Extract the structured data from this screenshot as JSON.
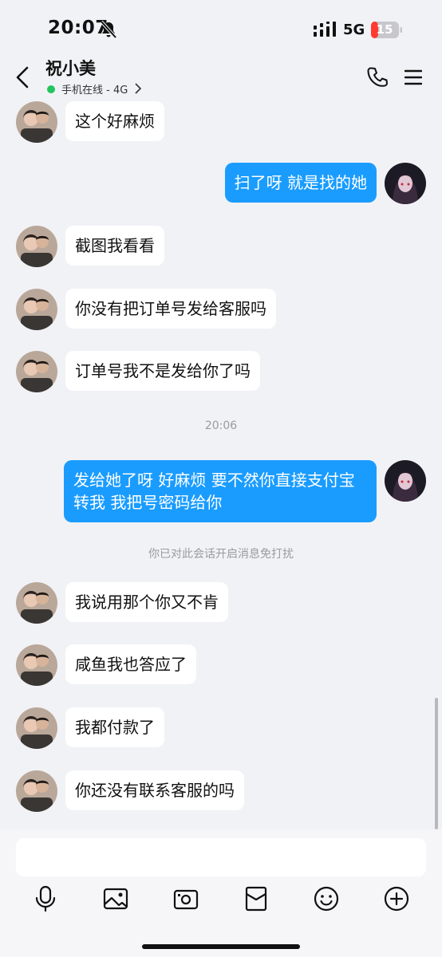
{
  "status_bar": {
    "time": "20:07",
    "network": "5G",
    "battery": "15",
    "icons": [
      "bell-off-icon",
      "signal-icon",
      "battery-icon"
    ]
  },
  "header": {
    "contact_name": "祝小美",
    "online_status": "手机在线 - 4G",
    "icons": [
      "back-icon",
      "phone-icon",
      "menu-icon"
    ]
  },
  "messages": [
    {
      "side": "in",
      "text": "这个好麻烦"
    },
    {
      "side": "out",
      "text": "扫了呀 就是找的她"
    },
    {
      "side": "in",
      "text": "截图我看看"
    },
    {
      "side": "in",
      "text": "你没有把订单号发给客服吗"
    },
    {
      "side": "in",
      "text": "订单号我不是发给你了吗"
    },
    {
      "side": "time",
      "text": "20:06"
    },
    {
      "side": "out",
      "text": "发给她了呀 好麻烦 要不然你直接支付宝转我 我把号密码给你"
    },
    {
      "side": "notice",
      "text": "你已对此会话开启消息免打扰"
    },
    {
      "side": "in",
      "text": "我说用那个你又不肯"
    },
    {
      "side": "in",
      "text": "咸鱼我也答应了"
    },
    {
      "side": "in",
      "text": "我都付款了"
    },
    {
      "side": "in",
      "text": "你还没有联系客服的吗"
    }
  ],
  "composer": {
    "input_value": "",
    "input_placeholder": "",
    "tools": [
      "microphone-icon",
      "image-icon",
      "camera-icon",
      "red-envelope-icon",
      "emoji-icon",
      "plus-icon"
    ]
  },
  "colors": {
    "background": "#f1f2f6",
    "incoming_bubble": "#ffffff",
    "outgoing_bubble": "#1a9cff",
    "online": "#22c55e",
    "battery_low": "#ff3b30"
  }
}
